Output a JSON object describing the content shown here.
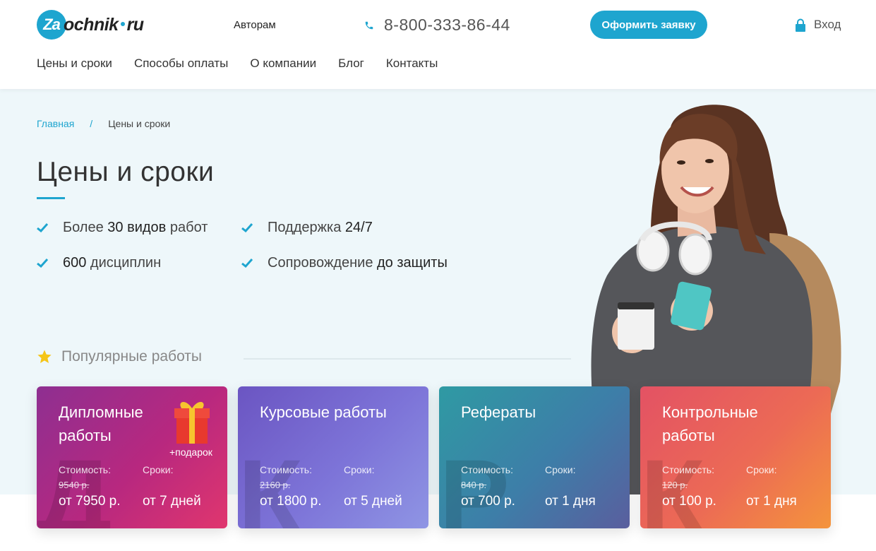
{
  "header": {
    "logo_prefix": "Za",
    "logo_main": "ochnik",
    "logo_suffix": "ru",
    "authors_link": "Авторам",
    "phone": "8-800-333-86-44",
    "order_button": "Оформить заявку",
    "login": "Вход"
  },
  "nav": {
    "items": [
      {
        "label": "Цены и сроки"
      },
      {
        "label": "Способы оплаты"
      },
      {
        "label": "О компании"
      },
      {
        "label": "Блог"
      },
      {
        "label": "Контакты"
      }
    ]
  },
  "breadcrumb": {
    "home": "Главная",
    "separator": "/",
    "current": "Цены и сроки"
  },
  "page_title": "Цены и сроки",
  "features": [
    {
      "before": "Более ",
      "bold": "30 видов",
      "after": " работ"
    },
    {
      "before": "Поддержка ",
      "bold": "24/7",
      "after": ""
    },
    {
      "before": "",
      "bold": "600",
      "after": " дисциплин"
    },
    {
      "before": "Сопровождение ",
      "bold": "до защиты",
      "after": ""
    }
  ],
  "popular_heading": "Популярные работы",
  "cards": [
    {
      "title": "Дипломные работы",
      "cost_label": "Стоимость:",
      "term_label": "Сроки:",
      "old_price": "9540 р.",
      "price": "от 7950 р.",
      "term": "от 7 дней",
      "gift_label": "+подарок",
      "bg_letter": "Д"
    },
    {
      "title": "Курсовые работы",
      "cost_label": "Стоимость:",
      "term_label": "Сроки:",
      "old_price": "2160 р.",
      "price": "от 1800 р.",
      "term": "от 5 дней",
      "bg_letter": "К"
    },
    {
      "title": "Рефераты",
      "cost_label": "Стоимость:",
      "term_label": "Сроки:",
      "old_price": "840 р.",
      "price": "от 700 р.",
      "term": "от 1 дня",
      "bg_letter": "Р"
    },
    {
      "title": "Контрольные работы",
      "cost_label": "Стоимость:",
      "term_label": "Сроки:",
      "old_price": "120 р.",
      "price": "от 100 р.",
      "term": "от 1 дня",
      "bg_letter": "К"
    }
  ],
  "colors": {
    "accent": "#1ea5cf",
    "hero_bg": "#eef7fa",
    "star": "#f5c518"
  },
  "icons": [
    "phone-icon",
    "lock-icon",
    "check-icon",
    "star-icon",
    "gift-icon"
  ]
}
